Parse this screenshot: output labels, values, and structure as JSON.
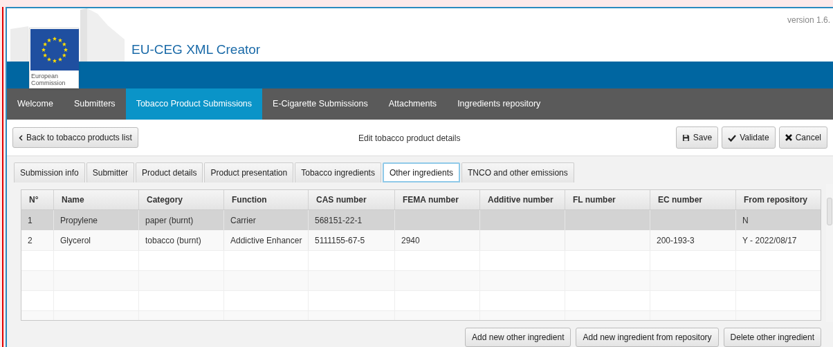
{
  "header": {
    "logo_text": "European Commission",
    "title": "EU-CEG XML Creator",
    "version": "version 1.6."
  },
  "nav": [
    {
      "label": "Welcome",
      "selected": false
    },
    {
      "label": "Submitters",
      "selected": false
    },
    {
      "label": "Tobacco Product Submissions",
      "selected": true
    },
    {
      "label": "E-Cigarette Submissions",
      "selected": false
    },
    {
      "label": "Attachments",
      "selected": false
    },
    {
      "label": "Ingredients repository",
      "selected": false
    }
  ],
  "toolbar": {
    "back": "Back to tobacco products list",
    "heading": "Edit tobacco product details",
    "actions": [
      {
        "kind": "save",
        "label": "Save"
      },
      {
        "kind": "validate",
        "label": "Validate"
      },
      {
        "kind": "cancel",
        "label": "Cancel"
      }
    ]
  },
  "tabs": [
    {
      "label": "Submission info",
      "selected": false
    },
    {
      "label": "Submitter",
      "selected": false
    },
    {
      "label": "Product details",
      "selected": false
    },
    {
      "label": "Product presentation",
      "selected": false
    },
    {
      "label": "Tobacco ingredients",
      "selected": false
    },
    {
      "label": "Other ingredients",
      "selected": true
    },
    {
      "label": "TNCO and other emissions",
      "selected": false
    }
  ],
  "table": {
    "columns": [
      "N°",
      "Name",
      "Category",
      "Function",
      "CAS number",
      "FEMA number",
      "Additive number",
      "FL number",
      "EC number",
      "From repository"
    ],
    "rows": [
      {
        "selected": true,
        "cells": [
          "1",
          "Propylene",
          "paper (burnt)",
          "Carrier",
          "568151-22-1",
          "",
          "",
          "",
          "",
          "N"
        ]
      },
      {
        "selected": false,
        "cells": [
          "2",
          "Glycerol",
          "tobacco (burnt)",
          "Addictive Enhancer",
          "5111155-67-5",
          "2940",
          "",
          "",
          "200-193-3",
          "Y - 2022/08/17"
        ]
      }
    ]
  },
  "buttons": [
    "Add new other ingredient",
    "Add new ingredient from repository",
    "Delete other ingredient"
  ]
}
